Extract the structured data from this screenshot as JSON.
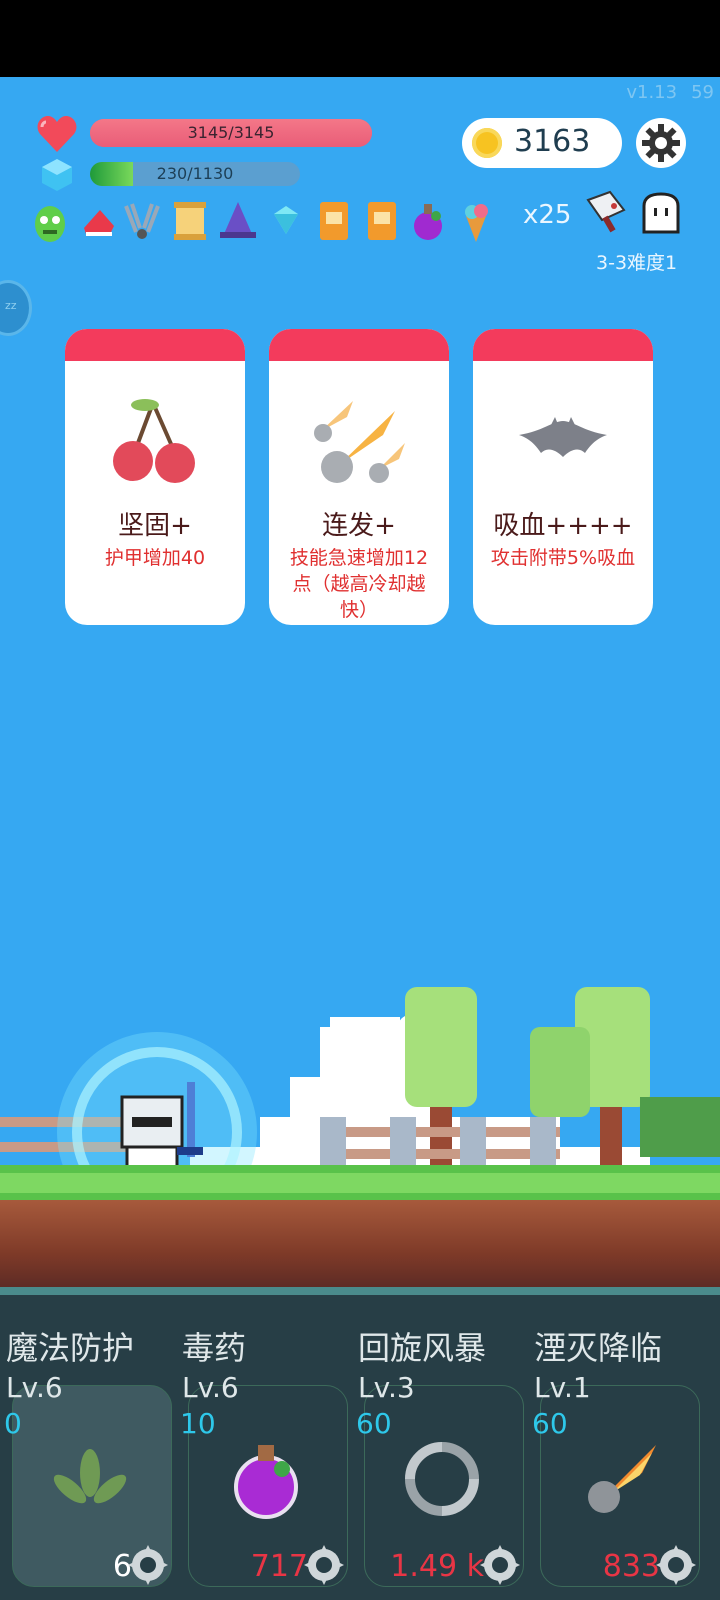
{
  "version": "v1.13",
  "fps": "59",
  "hp": {
    "text": "3145/3145",
    "current": 3145,
    "max": 3145
  },
  "mp": {
    "text": "230/1130",
    "current": 230,
    "max": 1130
  },
  "gold": "3163",
  "items_multiplier": "x25",
  "stage": "3-3难度1",
  "cards": [
    {
      "title": "坚固+",
      "desc": "护甲增加40",
      "icon": "cherry-icon"
    },
    {
      "title": "连发+",
      "desc": "技能急速增加12点（越高冷却越快）",
      "icon": "meteor-icon"
    },
    {
      "title": "吸血++++",
      "desc": "攻击附带5%吸血",
      "icon": "bat-icon"
    }
  ],
  "skills": [
    {
      "name": "魔法防护",
      "level": "Lv.6",
      "cost": "0",
      "count": "6",
      "icon": "leaf-icon"
    },
    {
      "name": "毒药",
      "level": "Lv.6",
      "cost": "10",
      "count": "717",
      "icon": "potion-icon"
    },
    {
      "name": "回旋风暴",
      "level": "Lv.3",
      "cost": "60",
      "count": "1.49 k",
      "icon": "whirlwind-icon"
    },
    {
      "name": "湮灭降临",
      "level": "Lv.1",
      "cost": "60",
      "count": "833",
      "icon": "meteor-icon"
    }
  ],
  "colors": {
    "sky": "#36a8f2",
    "card_header": "#f33b5c",
    "cost": "#2ec8ea",
    "count": "#e83545"
  }
}
